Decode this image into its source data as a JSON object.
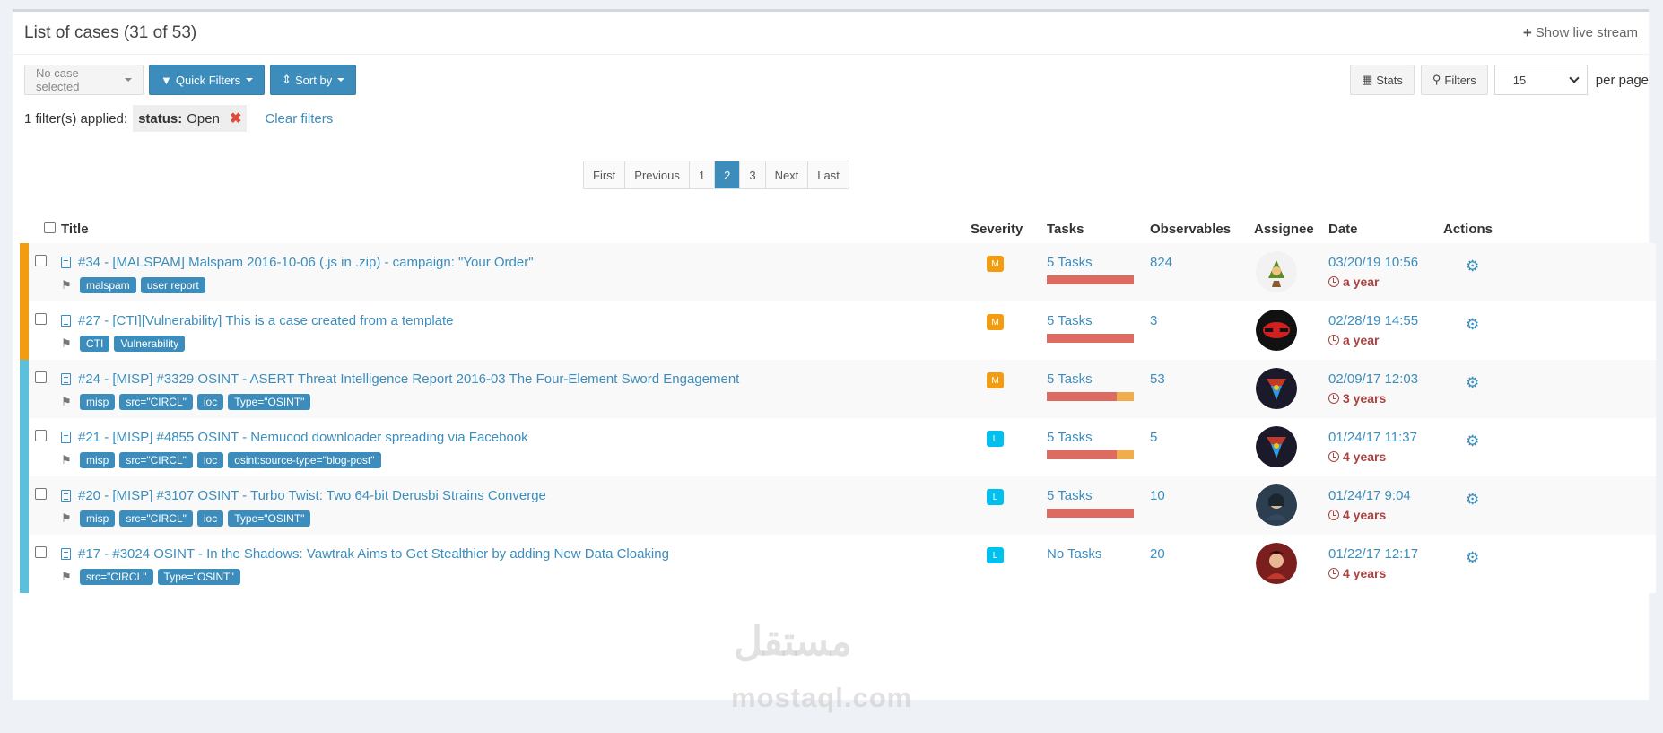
{
  "header": {
    "title": "List of cases (31 of 53)",
    "live_stream": "Show live stream"
  },
  "toolbar": {
    "case_select": "No case selected",
    "quick_filters": "Quick Filters",
    "sort_by": "Sort by",
    "stats": "Stats",
    "filters": "Filters",
    "per_page_value": "15",
    "per_page_label": "per page"
  },
  "filters": {
    "applied_label": "1 filter(s) applied:",
    "chip_key": "status:",
    "chip_value": "Open",
    "clear": "Clear filters"
  },
  "pagination": [
    "First",
    "Previous",
    "1",
    "2",
    "3",
    "Next",
    "Last"
  ],
  "pagination_active": "2",
  "columns": [
    "Title",
    "Severity",
    "Tasks",
    "Observables",
    "Assignee",
    "Date",
    "Actions"
  ],
  "rows": [
    {
      "title": "#34 - [MALSPAM] Malspam 2016-10-06 (.js in .zip) - campaign: \"Your Order\"",
      "tags": [
        "malspam",
        "user report"
      ],
      "severity": "M",
      "severity_color": "#f39c12",
      "marker_color": "#f39c12",
      "tasks": "5 Tasks",
      "tasks_done": 1.0,
      "tasks_other": 0.0,
      "observables": "824",
      "date": "03/20/19 10:56",
      "ago": "a year",
      "avatar": "link-avatar"
    },
    {
      "title": "#27 - [CTI][Vulnerability] This is a case created from a template",
      "tags": [
        "CTI",
        "Vulnerability"
      ],
      "severity": "M",
      "severity_color": "#f39c12",
      "marker_color": "#f39c12",
      "tasks": "5 Tasks",
      "tasks_done": 1.0,
      "tasks_other": 0.0,
      "observables": "3",
      "date": "02/28/19 14:55",
      "ago": "a year",
      "avatar": "red-symbol-avatar"
    },
    {
      "title": "#24 - [MISP] #3329 OSINT - ASERT Threat Intelligence Report 2016-03 The Four-Element Sword Engagement",
      "tags": [
        "misp",
        "src=\"CIRCL\"",
        "ioc",
        "Type=\"OSINT\""
      ],
      "severity": "M",
      "severity_color": "#f39c12",
      "marker_color": "#5bc0de",
      "tasks": "5 Tasks",
      "tasks_done": 0.8,
      "tasks_other": 0.2,
      "observables": "53",
      "date": "02/09/17 12:03",
      "ago": "3 years",
      "avatar": "shield-avatar"
    },
    {
      "title": "#21 - [MISP] #4855 OSINT - Nemucod downloader spreading via Facebook",
      "tags": [
        "misp",
        "src=\"CIRCL\"",
        "ioc",
        "osint:source-type=\"blog-post\""
      ],
      "severity": "L",
      "severity_color": "#00c0ef",
      "marker_color": "#5bc0de",
      "tasks": "5 Tasks",
      "tasks_done": 0.8,
      "tasks_other": 0.2,
      "observables": "5",
      "date": "01/24/17 11:37",
      "ago": "4 years",
      "avatar": "shield-avatar"
    },
    {
      "title": "#20 - [MISP] #3107 OSINT - Turbo Twist: Two 64-bit Derusbi Strains Converge",
      "tags": [
        "misp",
        "src=\"CIRCL\"",
        "ioc",
        "Type=\"OSINT\""
      ],
      "severity": "L",
      "severity_color": "#00c0ef",
      "marker_color": "#5bc0de",
      "tasks": "5 Tasks",
      "tasks_done": 1.0,
      "tasks_other": 0.0,
      "observables": "10",
      "date": "01/24/17 9:04",
      "ago": "4 years",
      "avatar": "person-avatar"
    },
    {
      "title": "#17 - #3024 OSINT - In the Shadows: Vawtrak Aims to Get Stealthier by adding New Data Cloaking",
      "tags": [
        "src=\"CIRCL\"",
        "Type=\"OSINT\""
      ],
      "severity": "L",
      "severity_color": "#00c0ef",
      "marker_color": "#5bc0de",
      "tasks": "No Tasks",
      "tasks_done": 0.0,
      "tasks_other": 0.0,
      "observables": "20",
      "date": "01/22/17 12:17",
      "ago": "4 years",
      "avatar": "hero-avatar"
    }
  ],
  "watermark": {
    "arabic": "مستقل",
    "latin": "mostaql.com"
  }
}
